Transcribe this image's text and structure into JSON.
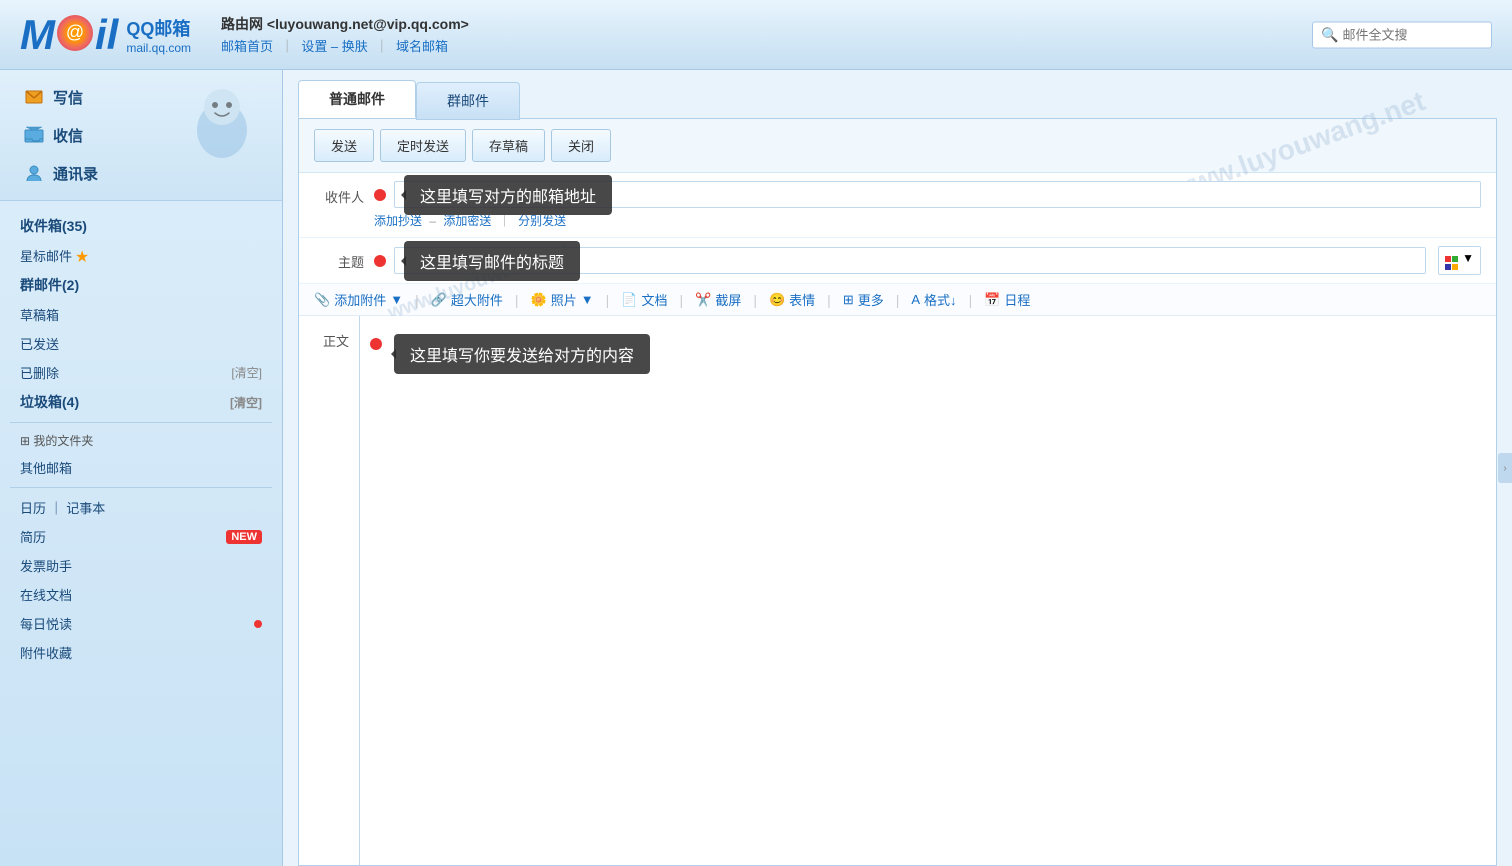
{
  "header": {
    "logo_m": "M",
    "logo_circle_icon": "mail-icon",
    "logo_ail": "ail",
    "qq_title": "QQ邮箱",
    "qq_sub": "mail.qq.com",
    "user_name": "路由网 <luyouwang.net@vip.qq.com>",
    "nav_links": [
      "邮箱首页",
      "设置 – 换肤",
      "域名邮箱"
    ],
    "search_placeholder": "邮件全文搜"
  },
  "sidebar": {
    "actions": [
      {
        "label": "写信",
        "icon": "compose-icon"
      },
      {
        "label": "收信",
        "icon": "inbox-icon"
      },
      {
        "label": "通讯录",
        "icon": "contacts-icon"
      }
    ],
    "nav": [
      {
        "label": "收件箱(35)",
        "bold": true,
        "count": ""
      },
      {
        "label": "星标邮件 ★",
        "star": true
      },
      {
        "label": "群邮件(2)",
        "bold": true
      },
      {
        "label": "草稿箱"
      },
      {
        "label": "已发送"
      },
      {
        "label": "已删除",
        "clear": "[清空]"
      },
      {
        "label": "垃圾箱(4)",
        "bold": true,
        "clear": "[清空]"
      }
    ],
    "folders_title": "⊞ 我的文件夹",
    "other_mailbox": "其他邮箱",
    "tools": [
      {
        "label": "日历",
        "sep": "｜",
        "label2": "记事本"
      },
      {
        "label": "简历",
        "badge": "NEW"
      },
      {
        "label": "发票助手"
      },
      {
        "label": "在线文档"
      },
      {
        "label": "每日悦读",
        "dot": true
      },
      {
        "label": "附件收藏"
      }
    ]
  },
  "compose": {
    "tabs": [
      {
        "label": "普通邮件",
        "active": true
      },
      {
        "label": "群邮件",
        "active": false
      }
    ],
    "toolbar_buttons": [
      {
        "label": "发送"
      },
      {
        "label": "定时发送"
      },
      {
        "label": "存草稿"
      },
      {
        "label": "关闭"
      }
    ],
    "recipient_label": "收件人",
    "recipient_placeholder": "",
    "recipient_tooltip": "这里填写对方的邮箱地址",
    "sub_links": {
      "add_cc": "添加抄送",
      "dash": "–",
      "add_bcc": "添加密送",
      "sep": "｜",
      "send_separately": "分别发送"
    },
    "subject_label": "主题",
    "subject_tooltip": "这里填写邮件的标题",
    "attachment_tools": [
      {
        "label": "添加附件",
        "icon": "paperclip-icon",
        "has_arrow": true
      },
      {
        "label": "超大附件",
        "icon": "link-icon"
      },
      {
        "label": "照片",
        "icon": "photo-icon",
        "has_arrow": true
      },
      {
        "label": "文档",
        "icon": "doc-icon"
      },
      {
        "label": "截屏",
        "icon": "scissors-icon"
      },
      {
        "label": "表情",
        "icon": "emoji-icon"
      },
      {
        "label": "更多",
        "icon": "more-icon"
      },
      {
        "label": "格式↓",
        "icon": "format-icon"
      },
      {
        "label": "日程",
        "icon": "calendar-icon"
      }
    ],
    "body_label": "正文",
    "body_tooltip": "这里填写你要发送给对方的内容"
  }
}
